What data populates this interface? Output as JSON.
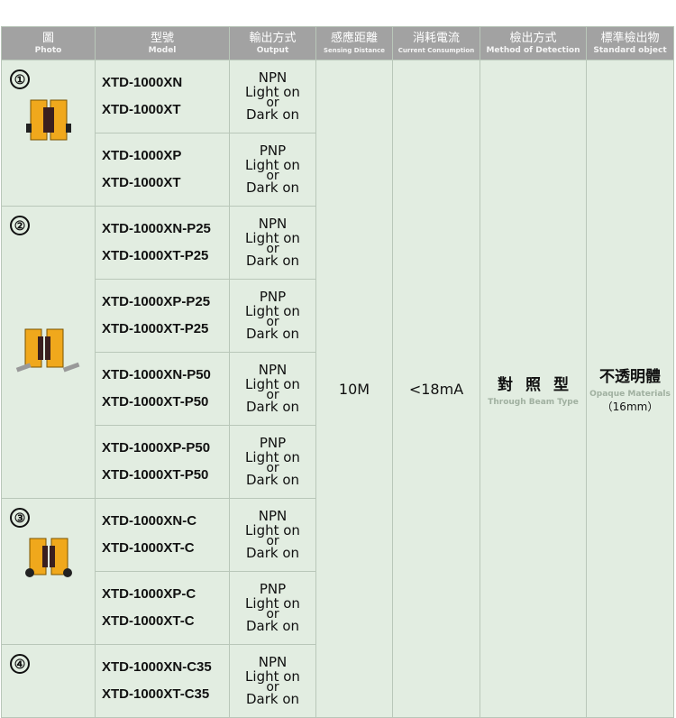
{
  "header": {
    "photo": {
      "zh": "圖",
      "en": "Photo"
    },
    "model": {
      "zh": "型號",
      "en": "Model"
    },
    "output": {
      "zh": "輸出方式",
      "en": "Output"
    },
    "distance": {
      "zh": "感應距離",
      "en": "Sensing Distance"
    },
    "current": {
      "zh": "消耗電流",
      "en": "Current Consumption"
    },
    "method": {
      "zh": "檢出方式",
      "en": "Method of Detection"
    },
    "standard": {
      "zh": "標準檢出物",
      "en": "Standard object"
    }
  },
  "groups": [
    {
      "number": "①",
      "icon": "sensor-pair-no-cable-icon"
    },
    {
      "number": "②",
      "icon": "sensor-pair-with-plug-icon"
    },
    {
      "number": "③",
      "icon": "sensor-pair-with-cable-icon"
    },
    {
      "number": "④",
      "icon": ""
    }
  ],
  "rows": [
    {
      "model_a": "XTD-1000XN",
      "model_b": "XTD-1000XT",
      "out_type": "NPN",
      "light": "Light  on",
      "or": "or",
      "dark": "Dark   on"
    },
    {
      "model_a": "XTD-1000XP",
      "model_b": "XTD-1000XT",
      "out_type": "PNP",
      "light": "Light  on",
      "or": "or",
      "dark": "Dark   on"
    },
    {
      "model_a": "XTD-1000XN-P25",
      "model_b": "XTD-1000XT-P25",
      "out_type": "NPN",
      "light": "Light  on",
      "or": "or",
      "dark": "Dark   on"
    },
    {
      "model_a": "XTD-1000XP-P25",
      "model_b": "XTD-1000XT-P25",
      "out_type": "PNP",
      "light": "Light  on",
      "or": "or",
      "dark": "Dark   on"
    },
    {
      "model_a": "XTD-1000XN-P50",
      "model_b": "XTD-1000XT-P50",
      "out_type": "NPN",
      "light": "Light  on",
      "or": "or",
      "dark": "Dark   on"
    },
    {
      "model_a": "XTD-1000XP-P50",
      "model_b": "XTD-1000XT-P50",
      "out_type": "PNP",
      "light": "Light  on",
      "or": "or",
      "dark": "Dark   on"
    },
    {
      "model_a": "XTD-1000XN-C",
      "model_b": "XTD-1000XT-C",
      "out_type": "NPN",
      "light": "Light  on",
      "or": "or",
      "dark": "Dark   on"
    },
    {
      "model_a": "XTD-1000XP-C",
      "model_b": "XTD-1000XT-C",
      "out_type": "PNP",
      "light": "Light  on",
      "or": "or",
      "dark": "Dark   on"
    },
    {
      "model_a": "XTD-1000XN-C35",
      "model_b": "XTD-1000XT-C35",
      "out_type": "NPN",
      "light": "Light  on",
      "or": "or",
      "dark": "Dark   on"
    }
  ],
  "shared": {
    "distance": "10M",
    "current": "<18mA",
    "method_zh": "對照型",
    "method_en": "Through Beam Type",
    "standard_zh": "不透明體",
    "standard_en": "Opaque Materials",
    "standard_size": "（16mm）"
  },
  "colors": {
    "header_bg": "#a2a2a2",
    "cell_bg": "#e2ede1",
    "grid": "#b9c7b9",
    "sensor_body": "#f0a81c"
  }
}
